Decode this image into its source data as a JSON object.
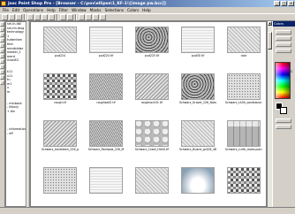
{
  "window": {
    "title": "Jasc Paint Shop Pro - [Browser - C:\\pov\\ellipse\\1_KF-1\\\\[image pw.bcc]]",
    "minimize": "_",
    "maximize": "□",
    "close": "x"
  },
  "menu": [
    "File",
    "Edit",
    "Operations",
    "Help",
    "Filter",
    "Window",
    "Masks",
    "Selections",
    "Colors",
    "Help"
  ],
  "folder_tree": {
    "top_items": [
      "sm-in-dbl",
      "sm-tin-ibug",
      "technology",
      "1",
      "tuttenfam",
      "titel",
      "mindbilder",
      "master_1",
      "merd",
      "ricon83"
    ],
    "mid_items": [
      "k11",
      "x11",
      "tu",
      "m1",
      "u",
      "m"
    ],
    "lower_items": [
      "- minback",
      "- ifstory",
      "+ bln"
    ],
    "bottom_items": [
      "- information",
      "- eff"
    ]
  },
  "thumbnails": [
    {
      "caption": "pud224",
      "style": "t-gray"
    },
    {
      "caption": "pud224 tif",
      "style": "t-light"
    },
    {
      "caption": "pud225 tif",
      "style": "t-dark"
    },
    {
      "caption": "pud30 tif",
      "style": "t-light"
    },
    {
      "caption": "rock",
      "style": "t-gray"
    },
    {
      "caption": "rough.tif",
      "style": "t-mosaic"
    },
    {
      "caption": "roughball2 tif",
      "style": "t-grain"
    },
    {
      "caption": "roughrock31 tif",
      "style": "t-wave"
    },
    {
      "caption": "Schwarz_Gravel_226_Nature",
      "style": "t-dark"
    },
    {
      "caption": "Schwarz_c400_sandstone.tif",
      "style": "t-dots"
    },
    {
      "caption": "Schwarz_kantsteen_226_pl",
      "style": "t-wave"
    },
    {
      "caption": "Schwarz_Rainbow_226_M",
      "style": "t-grain"
    },
    {
      "caption": "Schwarz_Crawl_Hd40.tif",
      "style": "t-bigstone"
    },
    {
      "caption": "Schwarz_Duane_gr428_48a",
      "style": "t-gray"
    },
    {
      "caption": "Schwarz_curfe_moes.pub.tif",
      "style": "t-tiles"
    },
    {
      "caption": "",
      "style": "t-dots"
    },
    {
      "caption": "",
      "style": "t-light"
    },
    {
      "caption": "",
      "style": "t-gray"
    },
    {
      "caption": "",
      "style": "t-cloud"
    },
    {
      "caption": "",
      "style": "t-mosaic"
    }
  ],
  "palette": {
    "title": "Colors",
    "label": "C"
  },
  "statusbar": {
    "text": ""
  }
}
